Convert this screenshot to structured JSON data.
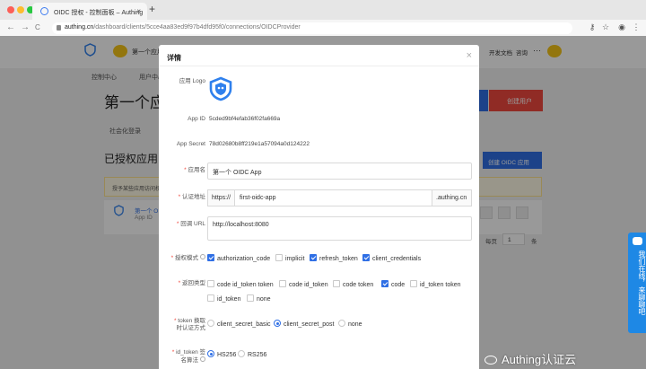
{
  "browser": {
    "tab_title": "OIDC 授权 - 控制面板 – Authing",
    "url_host": "authing.cn",
    "url_path": "/dashboard/clients/5cce4aa83ed9f97b4dfd95f0/connections/OIDCProvider",
    "new_tab": "+",
    "close_tab": "×",
    "back": "←",
    "forward": "→",
    "reload": "C",
    "key_icon": "⚷",
    "star_icon": "☆",
    "profile_icon": "◉",
    "menu_icon": "⋮"
  },
  "background": {
    "app_name": "第一个应用",
    "header_links": [
      "开发文档",
      "咨询"
    ],
    "header_more": "···",
    "nav": [
      "控制中心",
      "用户中心"
    ],
    "page_title": "第一个应",
    "btn_create_user": "创建用户",
    "tab_social": "社会化登录",
    "section_title": "已授权应用",
    "btn_create_oidc": "创建 OIDC 应用",
    "notice": "授予某些应用访问权限",
    "list_app_name": "第一个 OIDC",
    "list_app_sub": "App ID",
    "pager_label": "每页",
    "pager_value": "1",
    "pager_unit": "条"
  },
  "modal": {
    "title": "详情",
    "close": "×",
    "logo_label": "应用 Logo",
    "appid_label": "App ID",
    "appid_value": "5cded9bf4efab36f02fa669a",
    "secret_label": "App Secret",
    "secret_value": "78d02680b8ff219e1a57094a0d124222",
    "name_label": "应用名",
    "name_value": "第一个 OIDC App",
    "auth_label": "认证地址",
    "auth_prefix": "https://",
    "auth_value": "first-oidc-app",
    "auth_suffix": ".authing.cn",
    "callback_label": "回调 URL",
    "callback_value": "http://localhost:8080",
    "grant_label": "授权模式",
    "grants": [
      {
        "label": "authorization_code",
        "checked": true
      },
      {
        "label": "implicit",
        "checked": false
      },
      {
        "label": "refresh_token",
        "checked": true
      },
      {
        "label": "client_credentials",
        "checked": true
      }
    ],
    "response_label": "返回类型",
    "responses": [
      {
        "label": "code id_token token",
        "checked": false
      },
      {
        "label": "code id_token",
        "checked": false
      },
      {
        "label": "code token",
        "checked": false
      },
      {
        "label": "code",
        "checked": true
      },
      {
        "label": "id_token token",
        "checked": false
      },
      {
        "label": "id_token",
        "checked": false
      },
      {
        "label": "none",
        "checked": false
      }
    ],
    "token_auth_label_1": "token 换取",
    "token_auth_label_2": "时认证方式",
    "token_auth": [
      {
        "label": "client_secret_basic",
        "checked": false
      },
      {
        "label": "client_secret_post",
        "checked": true
      },
      {
        "label": "none",
        "checked": false
      }
    ],
    "sig_label_1": "id_token 签",
    "sig_label_2": "名算法",
    "sigs": [
      {
        "label": "HS256",
        "checked": true
      },
      {
        "label": "RS256",
        "checked": false
      }
    ]
  },
  "chat_widget": {
    "label": "我们在线，来聊聊吧"
  },
  "watermark": {
    "text": "Authing认证云"
  },
  "colors": {
    "accent": "#2f6fe5",
    "create_user": "#f0483e",
    "chat": "#1e88e5"
  }
}
